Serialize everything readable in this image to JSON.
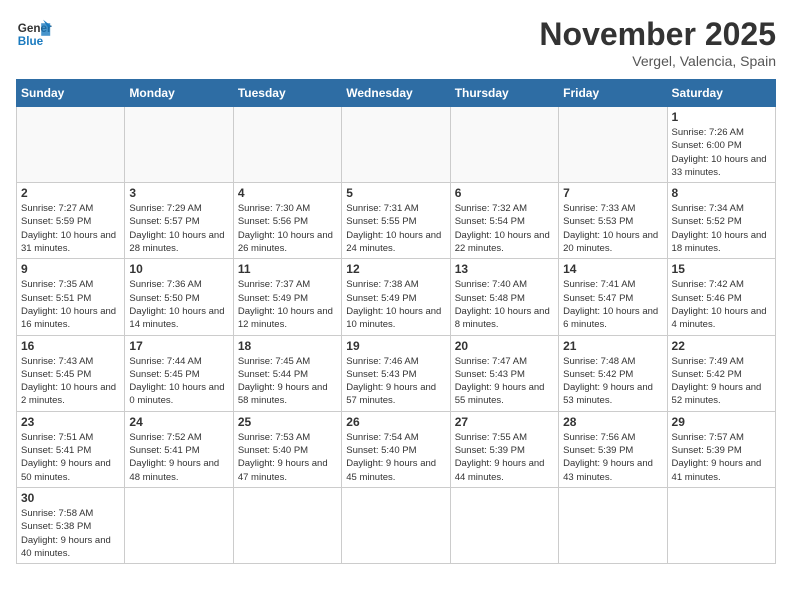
{
  "logo": {
    "text_general": "General",
    "text_blue": "Blue"
  },
  "header": {
    "month": "November 2025",
    "location": "Vergel, Valencia, Spain"
  },
  "days_of_week": [
    "Sunday",
    "Monday",
    "Tuesday",
    "Wednesday",
    "Thursday",
    "Friday",
    "Saturday"
  ],
  "weeks": [
    [
      {
        "day": "",
        "info": ""
      },
      {
        "day": "",
        "info": ""
      },
      {
        "day": "",
        "info": ""
      },
      {
        "day": "",
        "info": ""
      },
      {
        "day": "",
        "info": ""
      },
      {
        "day": "",
        "info": ""
      },
      {
        "day": "1",
        "info": "Sunrise: 7:26 AM\nSunset: 6:00 PM\nDaylight: 10 hours and 33 minutes."
      }
    ],
    [
      {
        "day": "2",
        "info": "Sunrise: 7:27 AM\nSunset: 5:59 PM\nDaylight: 10 hours and 31 minutes."
      },
      {
        "day": "3",
        "info": "Sunrise: 7:29 AM\nSunset: 5:57 PM\nDaylight: 10 hours and 28 minutes."
      },
      {
        "day": "4",
        "info": "Sunrise: 7:30 AM\nSunset: 5:56 PM\nDaylight: 10 hours and 26 minutes."
      },
      {
        "day": "5",
        "info": "Sunrise: 7:31 AM\nSunset: 5:55 PM\nDaylight: 10 hours and 24 minutes."
      },
      {
        "day": "6",
        "info": "Sunrise: 7:32 AM\nSunset: 5:54 PM\nDaylight: 10 hours and 22 minutes."
      },
      {
        "day": "7",
        "info": "Sunrise: 7:33 AM\nSunset: 5:53 PM\nDaylight: 10 hours and 20 minutes."
      },
      {
        "day": "8",
        "info": "Sunrise: 7:34 AM\nSunset: 5:52 PM\nDaylight: 10 hours and 18 minutes."
      }
    ],
    [
      {
        "day": "9",
        "info": "Sunrise: 7:35 AM\nSunset: 5:51 PM\nDaylight: 10 hours and 16 minutes."
      },
      {
        "day": "10",
        "info": "Sunrise: 7:36 AM\nSunset: 5:50 PM\nDaylight: 10 hours and 14 minutes."
      },
      {
        "day": "11",
        "info": "Sunrise: 7:37 AM\nSunset: 5:49 PM\nDaylight: 10 hours and 12 minutes."
      },
      {
        "day": "12",
        "info": "Sunrise: 7:38 AM\nSunset: 5:49 PM\nDaylight: 10 hours and 10 minutes."
      },
      {
        "day": "13",
        "info": "Sunrise: 7:40 AM\nSunset: 5:48 PM\nDaylight: 10 hours and 8 minutes."
      },
      {
        "day": "14",
        "info": "Sunrise: 7:41 AM\nSunset: 5:47 PM\nDaylight: 10 hours and 6 minutes."
      },
      {
        "day": "15",
        "info": "Sunrise: 7:42 AM\nSunset: 5:46 PM\nDaylight: 10 hours and 4 minutes."
      }
    ],
    [
      {
        "day": "16",
        "info": "Sunrise: 7:43 AM\nSunset: 5:45 PM\nDaylight: 10 hours and 2 minutes."
      },
      {
        "day": "17",
        "info": "Sunrise: 7:44 AM\nSunset: 5:45 PM\nDaylight: 10 hours and 0 minutes."
      },
      {
        "day": "18",
        "info": "Sunrise: 7:45 AM\nSunset: 5:44 PM\nDaylight: 9 hours and 58 minutes."
      },
      {
        "day": "19",
        "info": "Sunrise: 7:46 AM\nSunset: 5:43 PM\nDaylight: 9 hours and 57 minutes."
      },
      {
        "day": "20",
        "info": "Sunrise: 7:47 AM\nSunset: 5:43 PM\nDaylight: 9 hours and 55 minutes."
      },
      {
        "day": "21",
        "info": "Sunrise: 7:48 AM\nSunset: 5:42 PM\nDaylight: 9 hours and 53 minutes."
      },
      {
        "day": "22",
        "info": "Sunrise: 7:49 AM\nSunset: 5:42 PM\nDaylight: 9 hours and 52 minutes."
      }
    ],
    [
      {
        "day": "23",
        "info": "Sunrise: 7:51 AM\nSunset: 5:41 PM\nDaylight: 9 hours and 50 minutes."
      },
      {
        "day": "24",
        "info": "Sunrise: 7:52 AM\nSunset: 5:41 PM\nDaylight: 9 hours and 48 minutes."
      },
      {
        "day": "25",
        "info": "Sunrise: 7:53 AM\nSunset: 5:40 PM\nDaylight: 9 hours and 47 minutes."
      },
      {
        "day": "26",
        "info": "Sunrise: 7:54 AM\nSunset: 5:40 PM\nDaylight: 9 hours and 45 minutes."
      },
      {
        "day": "27",
        "info": "Sunrise: 7:55 AM\nSunset: 5:39 PM\nDaylight: 9 hours and 44 minutes."
      },
      {
        "day": "28",
        "info": "Sunrise: 7:56 AM\nSunset: 5:39 PM\nDaylight: 9 hours and 43 minutes."
      },
      {
        "day": "29",
        "info": "Sunrise: 7:57 AM\nSunset: 5:39 PM\nDaylight: 9 hours and 41 minutes."
      }
    ],
    [
      {
        "day": "30",
        "info": "Sunrise: 7:58 AM\nSunset: 5:38 PM\nDaylight: 9 hours and 40 minutes."
      },
      {
        "day": "",
        "info": ""
      },
      {
        "day": "",
        "info": ""
      },
      {
        "day": "",
        "info": ""
      },
      {
        "day": "",
        "info": ""
      },
      {
        "day": "",
        "info": ""
      },
      {
        "day": "",
        "info": ""
      }
    ]
  ]
}
